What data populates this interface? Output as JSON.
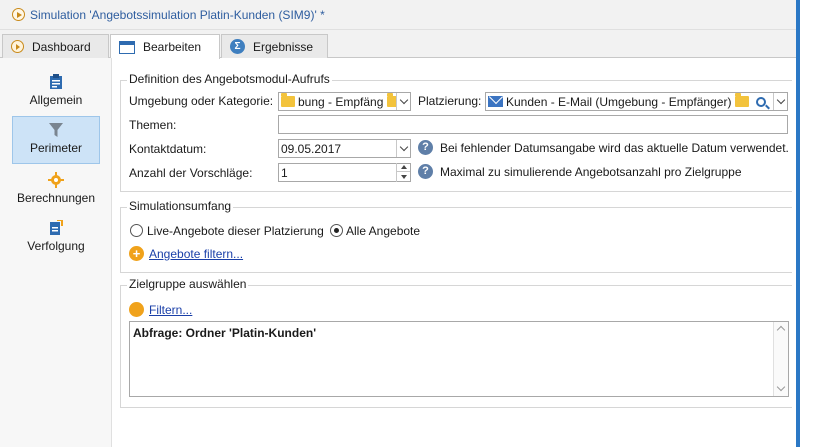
{
  "window": {
    "title": "Simulation 'Angebotssimulation Platin-Kunden (SIM9)' *"
  },
  "tabs": [
    {
      "label": "Dashboard",
      "icon": "dashboard-icon"
    },
    {
      "label": "Bearbeiten",
      "icon": "edit-form-icon"
    },
    {
      "label": "Ergebnisse",
      "icon": "sigma-icon"
    }
  ],
  "sidebar": {
    "items": [
      {
        "label": "Allgemein",
        "icon": "clipboard-icon"
      },
      {
        "label": "Perimeter",
        "icon": "funnel-icon"
      },
      {
        "label": "Berechnungen",
        "icon": "gear-icon"
      },
      {
        "label": "Verfolgung",
        "icon": "tracking-icon"
      }
    ]
  },
  "definition": {
    "title": "Definition des Angebotsmodul-Aufrufs",
    "environment_label": "Umgebung oder Kategorie:",
    "environment_value": "bung - Empfäng",
    "placement_label": "Platzierung:",
    "placement_value": "Kunden - E-Mail (Umgebung - Empfänger)",
    "themes_label": "Themen:",
    "themes_value": "",
    "contact_date_label": "Kontaktdatum:",
    "contact_date_value": "09.05.2017",
    "contact_date_help": "Bei fehlender Datumsangabe wird das aktuelle Datum verwendet.",
    "proposals_label": "Anzahl der Vorschläge:",
    "proposals_value": "1",
    "proposals_help": "Maximal zu simulierende Angebotsanzahl pro Zielgruppe"
  },
  "scope": {
    "title": "Simulationsumfang",
    "option_live": "Live-Angebote dieser Platzierung",
    "option_all": "Alle Angebote",
    "selected": "Alle Angebote",
    "filter_link": "Angebote filtern..."
  },
  "target": {
    "title": "Zielgruppe auswählen",
    "filter_link": "Filtern...",
    "query_text": "Abfrage: Ordner 'Platin-Kunden'"
  },
  "colors": {
    "accent": "#2b78c5",
    "link": "#1a3fa8",
    "orange": "#f0a21b",
    "selected_bg": "#cde3f7"
  }
}
